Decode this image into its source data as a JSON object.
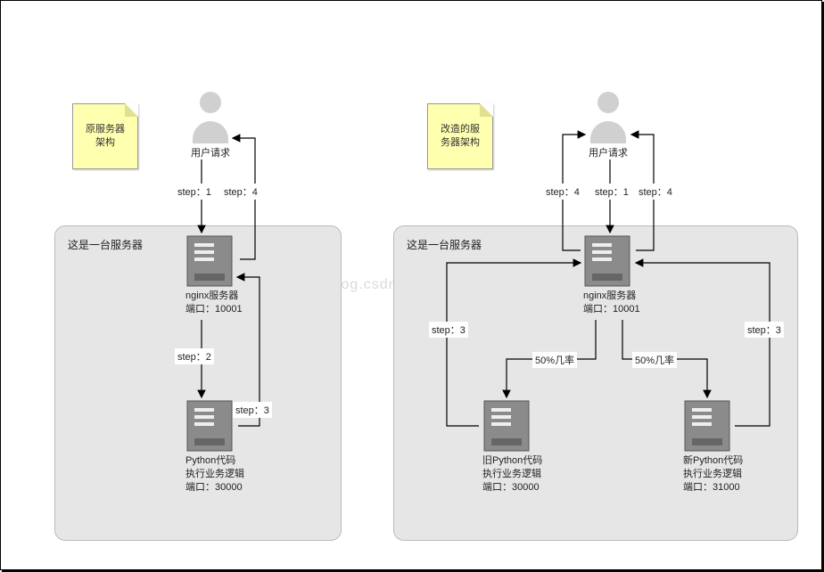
{
  "watermark": "http://blog.csdn.net/",
  "left": {
    "note": "原服务器\n架构",
    "box_label": "这是一台服务器",
    "actor_caption": "用户请求",
    "nginx_line1": "nginx服务器",
    "nginx_line2": "端口：10001",
    "python_line1": "Python代码",
    "python_line2": "执行业务逻辑",
    "python_line3": "端口：30000",
    "step1": "step：1",
    "step2": "step：2",
    "step3": "step：3",
    "step4": "step：4"
  },
  "right": {
    "note": "改造的服\n务器架构",
    "box_label": "这是一台服务器",
    "actor_caption": "用户请求",
    "nginx_line1": "nginx服务器",
    "nginx_line2": "端口：10001",
    "old_python_line1": "旧Python代码",
    "old_python_line2": "执行业务逻辑",
    "old_python_line3": "端口：30000",
    "new_python_line1": "新Python代码",
    "new_python_line2": "执行业务逻辑",
    "new_python_line3": "端口：31000",
    "step1": "step：1",
    "step3_left": "step：3",
    "step3_right": "step：3",
    "step4_left": "step：4",
    "step4_right": "step：4",
    "prob_left": "50%几率",
    "prob_right": "50%几率"
  }
}
